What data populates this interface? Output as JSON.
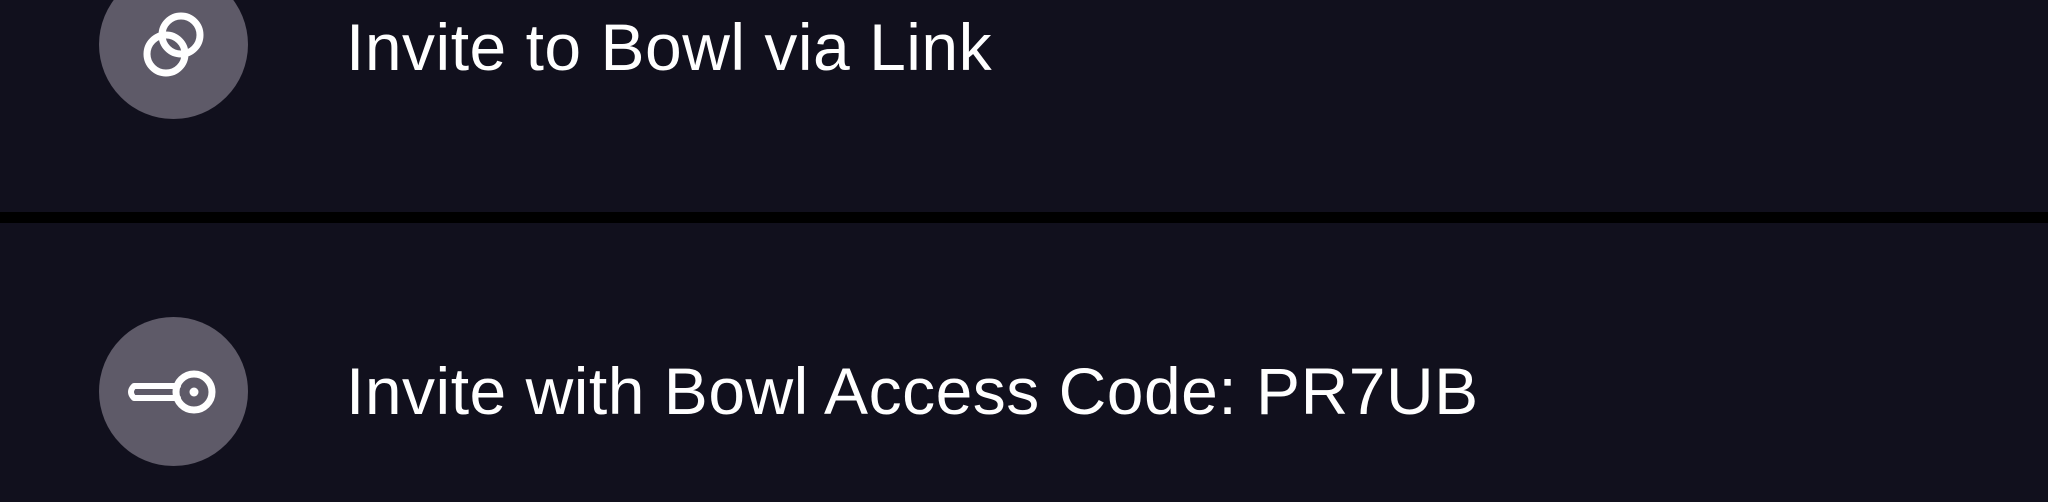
{
  "menu": {
    "items": [
      {
        "label": "Invite to Bowl via Link",
        "icon": "link-icon"
      },
      {
        "label": "Invite with Bowl Access Code: PR7UB",
        "icon": "key-icon"
      }
    ]
  },
  "colors": {
    "row_background": "#11101d",
    "icon_circle": "#5e5a68",
    "text": "#ffffff",
    "divider": "#000000"
  }
}
